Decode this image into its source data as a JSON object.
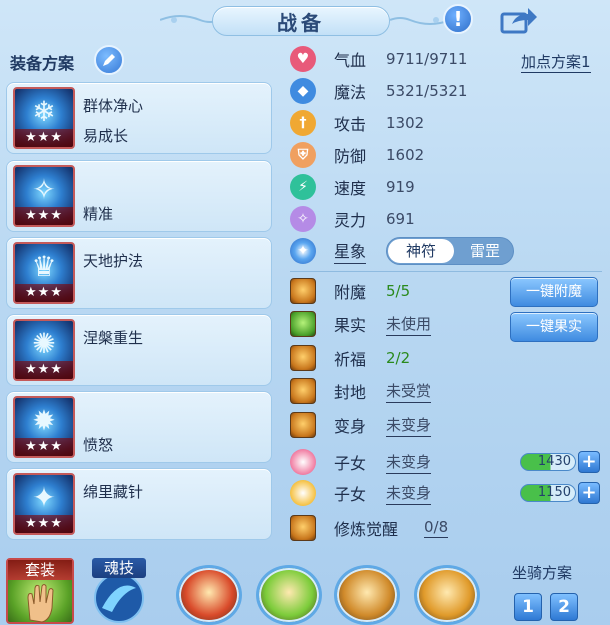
{
  "header": {
    "title": "战备",
    "info_icon": "exclamation-icon",
    "share_icon": "share-icon"
  },
  "equipment": {
    "title": "装备方案",
    "edit_icon": "pencil-icon",
    "skills": [
      {
        "line1": "群体净心",
        "line2": "易成长",
        "stars": "★★★"
      },
      {
        "line1": "",
        "line2": "精准",
        "stars": "★★★"
      },
      {
        "line1": "天地护法",
        "line2": "",
        "stars": "★★★"
      },
      {
        "line1": "涅槃重生",
        "line2": "",
        "stars": "★★★"
      },
      {
        "line1": "",
        "line2": "愤怒",
        "stars": "★★★"
      },
      {
        "line1": "绵里藏针",
        "line2": "",
        "stars": "★★★"
      }
    ]
  },
  "stats": {
    "plan_link": "加点方案1",
    "items": [
      {
        "label": "气血",
        "value": "9711/9711",
        "color": "#e85a7a",
        "icon": "heart-icon"
      },
      {
        "label": "魔法",
        "value": "5321/5321",
        "color": "#3f8be0",
        "icon": "mana-icon"
      },
      {
        "label": "攻击",
        "value": "1302",
        "color": "#f0a833",
        "icon": "sword-icon"
      },
      {
        "label": "防御",
        "value": "1602",
        "color": "#f0a060",
        "icon": "shield-icon"
      },
      {
        "label": "速度",
        "value": "919",
        "color": "#2fc19a",
        "icon": "speed-icon"
      },
      {
        "label": "灵力",
        "value": "691",
        "color": "#b58be6",
        "icon": "spirit-icon"
      }
    ],
    "star_sign": {
      "label": "星象",
      "option_active": "神符",
      "option_inactive": "雷罡"
    }
  },
  "enhance": {
    "items": [
      {
        "label": "附魔",
        "value": "5/5",
        "green": true,
        "icon": "enchant-icon",
        "icon_style": "orange"
      },
      {
        "label": "果实",
        "value": "未使用",
        "green": false,
        "icon": "fruit-icon",
        "icon_style": "green"
      },
      {
        "label": "祈福",
        "value": "2/2",
        "green": true,
        "icon": "blessing-icon",
        "icon_style": "orange"
      },
      {
        "label": "封地",
        "value": "未受赏",
        "green": false,
        "icon": "fief-icon",
        "icon_style": "orange"
      },
      {
        "label": "变身",
        "value": "未变身",
        "green": false,
        "icon": "transform-icon",
        "icon_style": "orange"
      }
    ],
    "children": [
      {
        "label": "子女",
        "value": "未变身",
        "bar": "1430",
        "icon": "child-pink-icon",
        "color": "#f07aa0"
      },
      {
        "label": "子女",
        "value": "未变身",
        "bar": "1150",
        "icon": "child-gold-icon",
        "color": "#f5c040"
      }
    ],
    "cultivation": {
      "label": "修炼觉醒",
      "value": "0/8",
      "icon": "cultivation-icon"
    },
    "buttons": {
      "enchant": "一键附魔",
      "fruit": "一键果实",
      "plus": "+"
    }
  },
  "bottom": {
    "suit_label": "套装",
    "soul_label": "魂技",
    "pets": [
      {
        "icon": "red-beast-icon",
        "color": "#d94a2a"
      },
      {
        "icon": "green-leaf-icon",
        "color": "#7ccc3a"
      },
      {
        "icon": "warrior-icon",
        "color": "#d08a2a"
      },
      {
        "icon": "golden-monk-icon",
        "color": "#e09a2a"
      }
    ],
    "mount_title": "坐骑方案",
    "mount_options": [
      "1",
      "2"
    ]
  }
}
